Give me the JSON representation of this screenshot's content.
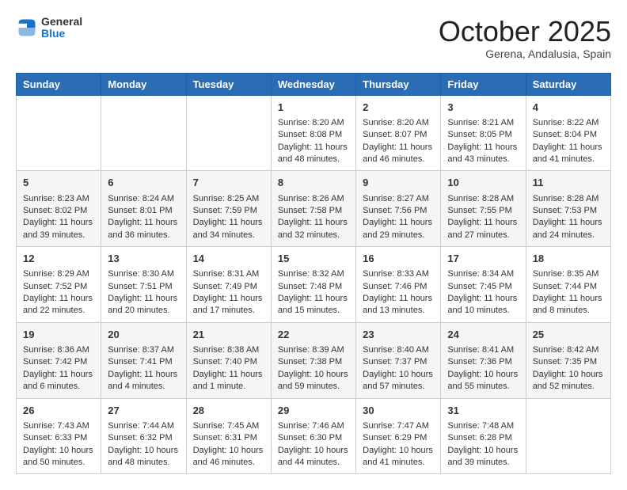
{
  "logo": {
    "general": "General",
    "blue": "Blue"
  },
  "header": {
    "month": "October 2025",
    "location": "Gerena, Andalusia, Spain"
  },
  "weekdays": [
    "Sunday",
    "Monday",
    "Tuesday",
    "Wednesday",
    "Thursday",
    "Friday",
    "Saturday"
  ],
  "weeks": [
    [
      {
        "day": "",
        "info": ""
      },
      {
        "day": "",
        "info": ""
      },
      {
        "day": "",
        "info": ""
      },
      {
        "day": "1",
        "info": "Sunrise: 8:20 AM\nSunset: 8:08 PM\nDaylight: 11 hours and 48 minutes."
      },
      {
        "day": "2",
        "info": "Sunrise: 8:20 AM\nSunset: 8:07 PM\nDaylight: 11 hours and 46 minutes."
      },
      {
        "day": "3",
        "info": "Sunrise: 8:21 AM\nSunset: 8:05 PM\nDaylight: 11 hours and 43 minutes."
      },
      {
        "day": "4",
        "info": "Sunrise: 8:22 AM\nSunset: 8:04 PM\nDaylight: 11 hours and 41 minutes."
      }
    ],
    [
      {
        "day": "5",
        "info": "Sunrise: 8:23 AM\nSunset: 8:02 PM\nDaylight: 11 hours and 39 minutes."
      },
      {
        "day": "6",
        "info": "Sunrise: 8:24 AM\nSunset: 8:01 PM\nDaylight: 11 hours and 36 minutes."
      },
      {
        "day": "7",
        "info": "Sunrise: 8:25 AM\nSunset: 7:59 PM\nDaylight: 11 hours and 34 minutes."
      },
      {
        "day": "8",
        "info": "Sunrise: 8:26 AM\nSunset: 7:58 PM\nDaylight: 11 hours and 32 minutes."
      },
      {
        "day": "9",
        "info": "Sunrise: 8:27 AM\nSunset: 7:56 PM\nDaylight: 11 hours and 29 minutes."
      },
      {
        "day": "10",
        "info": "Sunrise: 8:28 AM\nSunset: 7:55 PM\nDaylight: 11 hours and 27 minutes."
      },
      {
        "day": "11",
        "info": "Sunrise: 8:28 AM\nSunset: 7:53 PM\nDaylight: 11 hours and 24 minutes."
      }
    ],
    [
      {
        "day": "12",
        "info": "Sunrise: 8:29 AM\nSunset: 7:52 PM\nDaylight: 11 hours and 22 minutes."
      },
      {
        "day": "13",
        "info": "Sunrise: 8:30 AM\nSunset: 7:51 PM\nDaylight: 11 hours and 20 minutes."
      },
      {
        "day": "14",
        "info": "Sunrise: 8:31 AM\nSunset: 7:49 PM\nDaylight: 11 hours and 17 minutes."
      },
      {
        "day": "15",
        "info": "Sunrise: 8:32 AM\nSunset: 7:48 PM\nDaylight: 11 hours and 15 minutes."
      },
      {
        "day": "16",
        "info": "Sunrise: 8:33 AM\nSunset: 7:46 PM\nDaylight: 11 hours and 13 minutes."
      },
      {
        "day": "17",
        "info": "Sunrise: 8:34 AM\nSunset: 7:45 PM\nDaylight: 11 hours and 10 minutes."
      },
      {
        "day": "18",
        "info": "Sunrise: 8:35 AM\nSunset: 7:44 PM\nDaylight: 11 hours and 8 minutes."
      }
    ],
    [
      {
        "day": "19",
        "info": "Sunrise: 8:36 AM\nSunset: 7:42 PM\nDaylight: 11 hours and 6 minutes."
      },
      {
        "day": "20",
        "info": "Sunrise: 8:37 AM\nSunset: 7:41 PM\nDaylight: 11 hours and 4 minutes."
      },
      {
        "day": "21",
        "info": "Sunrise: 8:38 AM\nSunset: 7:40 PM\nDaylight: 11 hours and 1 minute."
      },
      {
        "day": "22",
        "info": "Sunrise: 8:39 AM\nSunset: 7:38 PM\nDaylight: 10 hours and 59 minutes."
      },
      {
        "day": "23",
        "info": "Sunrise: 8:40 AM\nSunset: 7:37 PM\nDaylight: 10 hours and 57 minutes."
      },
      {
        "day": "24",
        "info": "Sunrise: 8:41 AM\nSunset: 7:36 PM\nDaylight: 10 hours and 55 minutes."
      },
      {
        "day": "25",
        "info": "Sunrise: 8:42 AM\nSunset: 7:35 PM\nDaylight: 10 hours and 52 minutes."
      }
    ],
    [
      {
        "day": "26",
        "info": "Sunrise: 7:43 AM\nSunset: 6:33 PM\nDaylight: 10 hours and 50 minutes."
      },
      {
        "day": "27",
        "info": "Sunrise: 7:44 AM\nSunset: 6:32 PM\nDaylight: 10 hours and 48 minutes."
      },
      {
        "day": "28",
        "info": "Sunrise: 7:45 AM\nSunset: 6:31 PM\nDaylight: 10 hours and 46 minutes."
      },
      {
        "day": "29",
        "info": "Sunrise: 7:46 AM\nSunset: 6:30 PM\nDaylight: 10 hours and 44 minutes."
      },
      {
        "day": "30",
        "info": "Sunrise: 7:47 AM\nSunset: 6:29 PM\nDaylight: 10 hours and 41 minutes."
      },
      {
        "day": "31",
        "info": "Sunrise: 7:48 AM\nSunset: 6:28 PM\nDaylight: 10 hours and 39 minutes."
      },
      {
        "day": "",
        "info": ""
      }
    ]
  ]
}
